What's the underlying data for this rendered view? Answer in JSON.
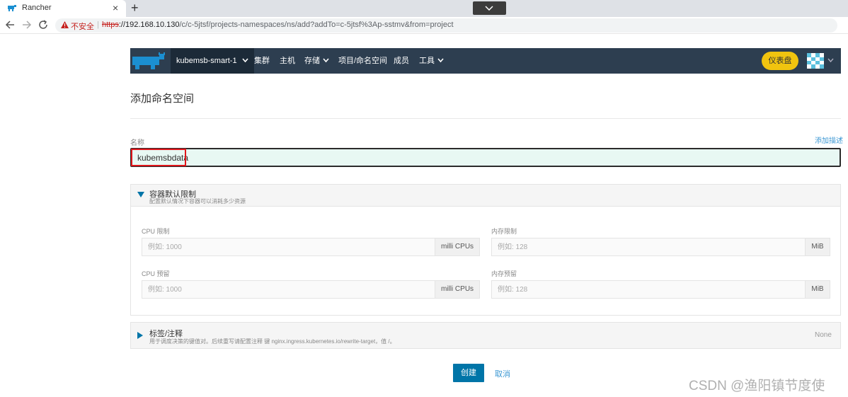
{
  "browser": {
    "tab_title": "Rancher",
    "close_glyph": "×",
    "new_tab_glyph": "+",
    "security_label": "不安全",
    "separator": "|",
    "url_protocol": "https",
    "url_host": "://192.168.10.130",
    "url_path": "/c/c-5jtsf/projects-namespaces/ns/add?addTo=c-5jtsf%3Ap-sstmv&from=project"
  },
  "header": {
    "cluster_label": "kubemsb-smart-1",
    "nav": [
      {
        "label": "集群"
      },
      {
        "label": "主机"
      },
      {
        "label": "存储"
      },
      {
        "label": "项目/命名空间"
      },
      {
        "label": "成员"
      },
      {
        "label": "工具"
      }
    ],
    "dashboard_label": "仪表盘",
    "colors": {
      "bg": "#2d3e50",
      "cluster_bg": "#1c2a38",
      "accent": "#f1c40f",
      "logo": "#1b8fd1"
    }
  },
  "page": {
    "title": "添加命名空间",
    "name_label": "名称",
    "add_description": "添加描述",
    "name_value": "kubemsbdata"
  },
  "limits": {
    "title": "容器默认限制",
    "subtitle": "配置默认情况下容器可以消耗多少资源",
    "cpu_limit_label": "CPU 限制",
    "cpu_limit_placeholder": "例如: 1000",
    "cpu_limit_unit": "milli CPUs",
    "mem_limit_label": "内存限制",
    "mem_limit_placeholder": "例如: 128",
    "mem_limit_unit": "MiB",
    "cpu_reserve_label": "CPU 预留",
    "cpu_reserve_placeholder": "例如: 1000",
    "cpu_reserve_unit": "milli CPUs",
    "mem_reserve_label": "内存预留",
    "mem_reserve_placeholder": "例如: 128",
    "mem_reserve_unit": "MiB"
  },
  "labels": {
    "title": "标签/注释",
    "subtitle": "用于调度决策的键值对。后续重写请配置注释 键 nginx.ingress.kubernetes.io/rewrite-target，值 /。",
    "status": "None"
  },
  "actions": {
    "create_label": "创建",
    "cancel_label": "取消"
  },
  "watermark": "CSDN @渔阳镇节度使",
  "icons": [
    "rancher-favicon-icon",
    "close-icon",
    "plus-icon",
    "chevron-down-icon",
    "back-arrow-icon",
    "forward-arrow-icon",
    "reload-icon",
    "warning-icon",
    "rancher-logo-icon",
    "avatar-icon",
    "triangle-down-icon",
    "triangle-right-icon"
  ]
}
